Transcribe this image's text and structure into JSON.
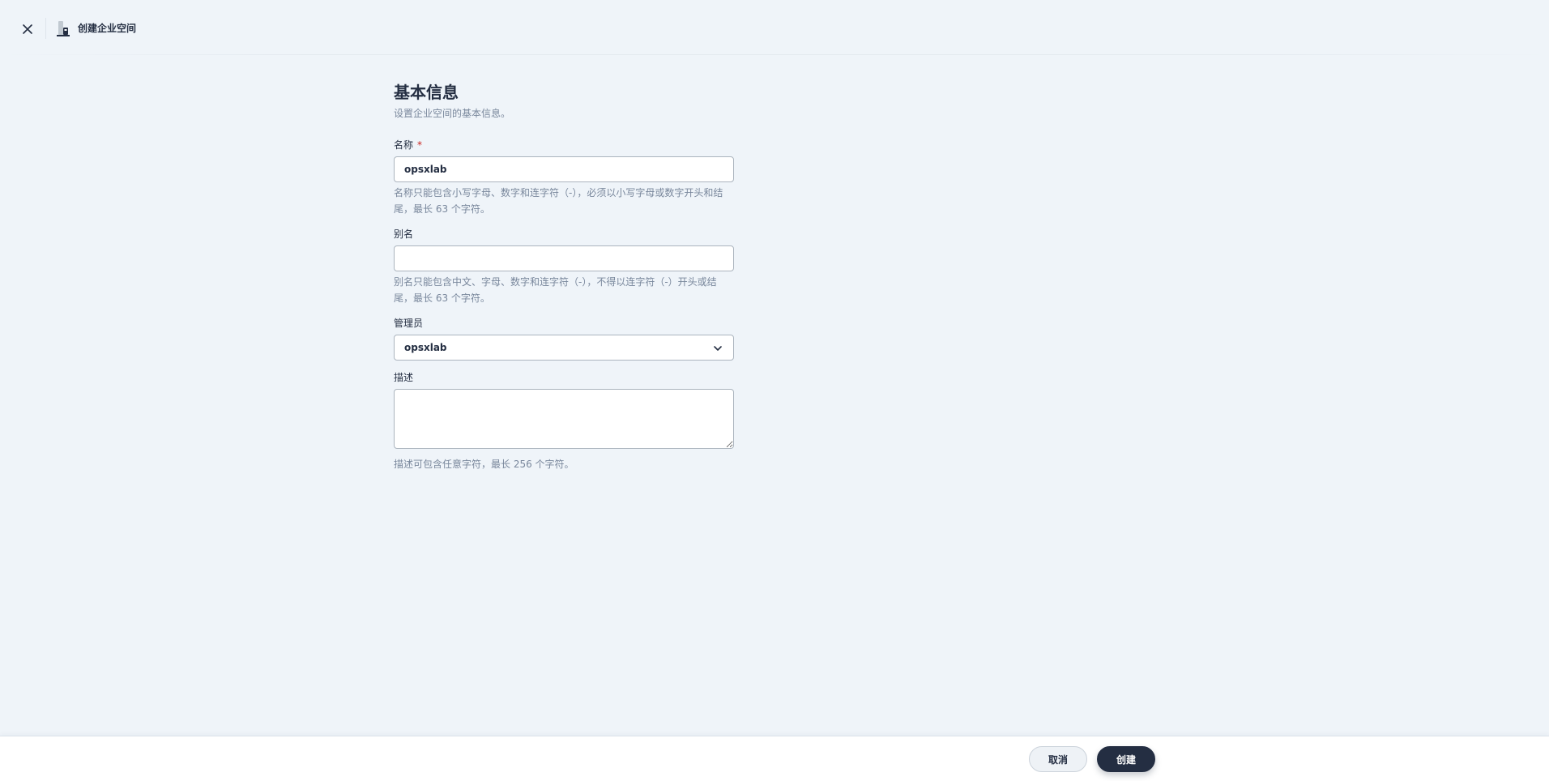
{
  "header": {
    "title": "创建企业空间"
  },
  "section": {
    "title": "基本信息",
    "description": "设置企业空间的基本信息。"
  },
  "fields": {
    "name": {
      "label": "名称",
      "required_mark": "*",
      "value": "opsxlab",
      "help": "名称只能包含小写字母、数字和连字符（-），必须以小写字母或数字开头和结尾，最长 63 个字符。"
    },
    "alias": {
      "label": "别名",
      "value": "",
      "help": "别名只能包含中文、字母、数字和连字符（-），不得以连字符（-）开头或结尾，最长 63 个字符。"
    },
    "admin": {
      "label": "管理员",
      "value": "opsxlab"
    },
    "description": {
      "label": "描述",
      "value": "",
      "help": "描述可包含任意字符，最长 256 个字符。"
    }
  },
  "footer": {
    "cancel_label": "取消",
    "create_label": "创建"
  },
  "colors": {
    "background": "#eff4f9",
    "primary": "#242e42",
    "required": "#ca2621",
    "muted_text": "#79879c"
  },
  "icons": {
    "close": "close-icon",
    "title": "enterprise-workspace-icon",
    "select_caret": "chevron-down-icon"
  }
}
